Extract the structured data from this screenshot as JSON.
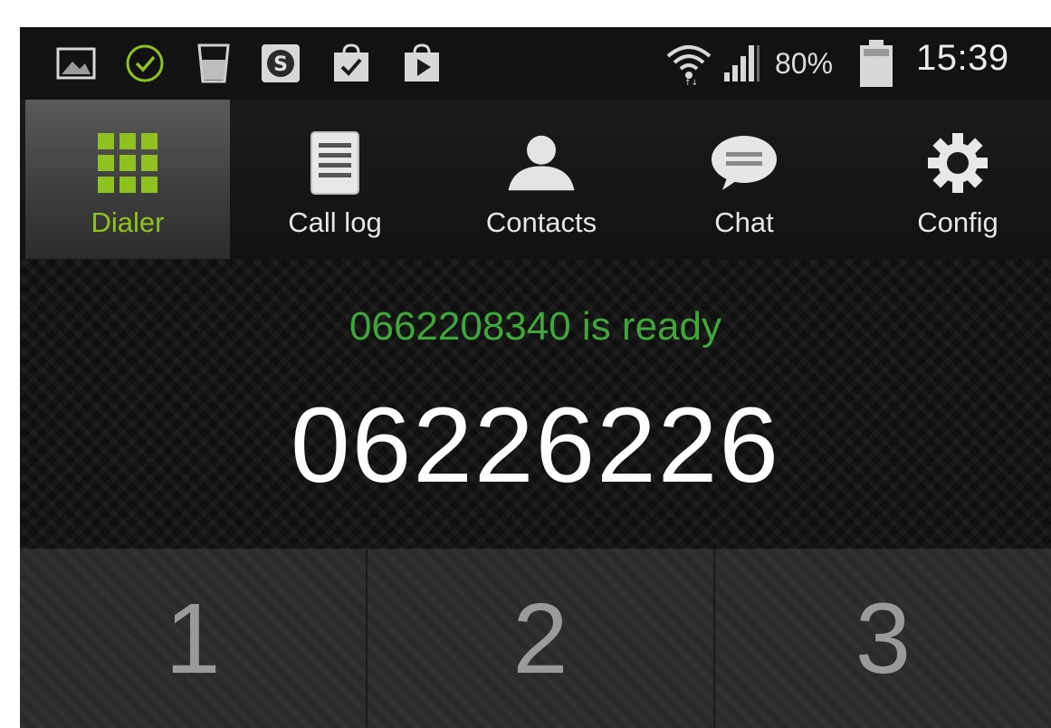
{
  "status_bar": {
    "left_icons": [
      "gallery-icon",
      "check-circle-icon",
      "glass-icon",
      "skype-icon",
      "checkbox-bag-icon",
      "play-store-icon"
    ],
    "right_icons": [
      "wifi-icon",
      "signal-icon",
      "battery-icon"
    ],
    "battery_percent": "80%",
    "time": "15:39"
  },
  "tabs": [
    {
      "label": "Dialer",
      "icon": "keypad-grid-icon",
      "active": true
    },
    {
      "label": "Call log",
      "icon": "document-list-icon",
      "active": false
    },
    {
      "label": "Contacts",
      "icon": "person-icon",
      "active": false
    },
    {
      "label": "Chat",
      "icon": "speech-bubble-icon",
      "active": false
    },
    {
      "label": "Config",
      "icon": "gear-icon",
      "active": false
    }
  ],
  "dialer": {
    "status": "0662208340 is ready",
    "entered_number": "06226226"
  },
  "keypad": {
    "keys": [
      "1",
      "2",
      "3"
    ]
  },
  "colors": {
    "accent_green": "#8fc21f",
    "status_green": "#3fa63a",
    "background": "#0c0c0c"
  }
}
